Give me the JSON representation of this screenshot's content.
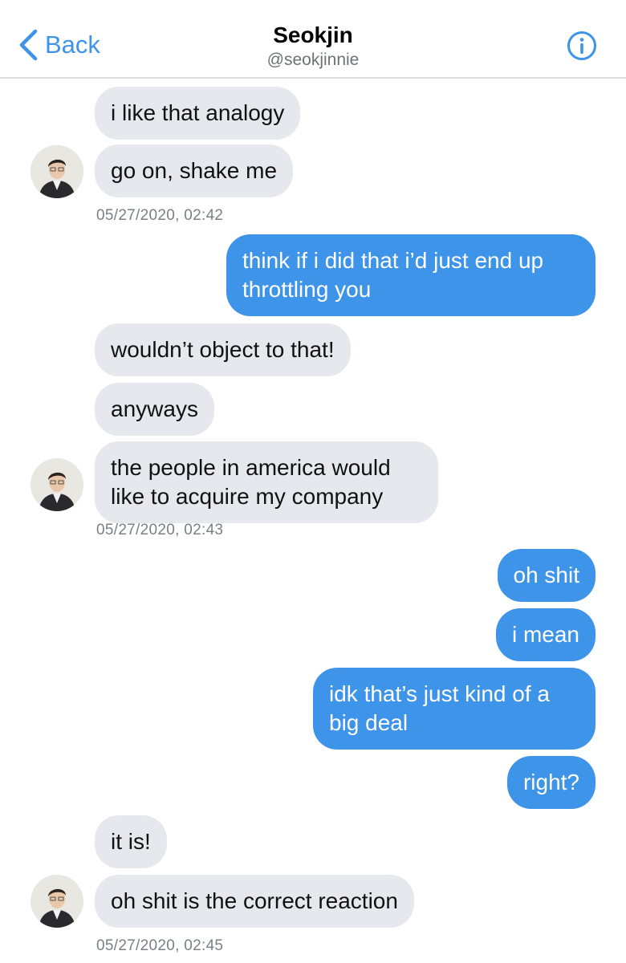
{
  "header": {
    "back_label": "Back",
    "title": "Seokjin",
    "handle": "@seokjinnie"
  },
  "messages": [
    {
      "side": "in",
      "text": "i like that analogy"
    },
    {
      "side": "in",
      "text": "go on, shake me"
    },
    {
      "timestamp": "05/27/2020, 02:42"
    },
    {
      "side": "out",
      "text": "think if i did that i’d just end up throttling you"
    },
    {
      "side": "in",
      "text": "wouldn’t object to that!"
    },
    {
      "side": "in",
      "text": "anyways"
    },
    {
      "side": "in",
      "text": "the people in america would like to acquire my company"
    },
    {
      "timestamp": "05/27/2020, 02:43"
    },
    {
      "side": "out",
      "text": "oh shit"
    },
    {
      "side": "out",
      "text": "i mean"
    },
    {
      "side": "out",
      "text": "idk that’s just kind of a big deal"
    },
    {
      "side": "out",
      "text": "right?"
    },
    {
      "side": "in",
      "text": "it is!"
    },
    {
      "side": "in",
      "text": "oh shit is the correct reaction"
    },
    {
      "timestamp": "05/27/2020, 02:45"
    }
  ],
  "colors": {
    "accent": "#3d94e8",
    "incoming_bubble": "#e6e8ed",
    "outgoing_bubble": "#3d94e8"
  },
  "icons": {
    "back": "chevron-left-icon",
    "info": "info-circle-icon"
  }
}
